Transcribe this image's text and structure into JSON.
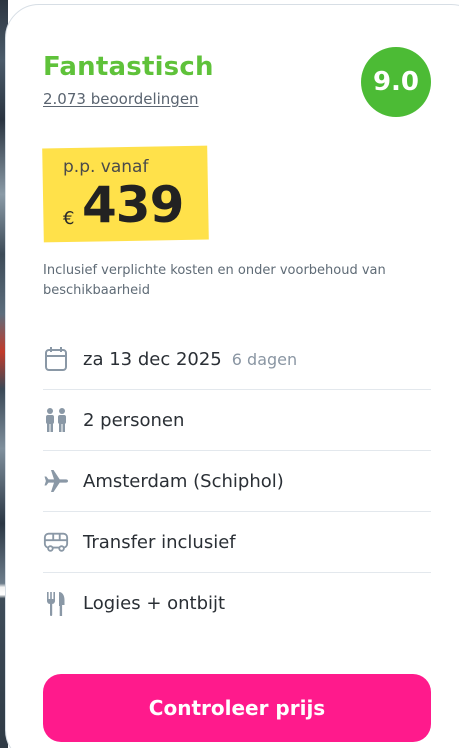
{
  "rating": {
    "label": "Fantastisch",
    "reviews_text": "2.073 beoordelingen",
    "score": "9.0",
    "color": "#5fc23a"
  },
  "price": {
    "label": "p.p. vanaf",
    "currency": "€",
    "amount": "439",
    "highlight_color": "#ffe14a"
  },
  "disclaimer": "Inclusief verplichte kosten en onder voorbehoud van beschikbaarheid",
  "details": {
    "date": {
      "icon": "calendar-icon",
      "text": "za 13 dec 2025",
      "duration": "6 dagen"
    },
    "persons": {
      "icon": "people-icon",
      "text": "2 personen"
    },
    "departure": {
      "icon": "airplane-icon",
      "text": "Amsterdam (Schiphol)"
    },
    "transfer": {
      "icon": "bus-icon",
      "text": "Transfer inclusief"
    },
    "board": {
      "icon": "fork-knife-icon",
      "text": "Logies + ontbijt"
    }
  },
  "cta": {
    "label": "Controleer prijs",
    "color": "#ff1a8c"
  }
}
